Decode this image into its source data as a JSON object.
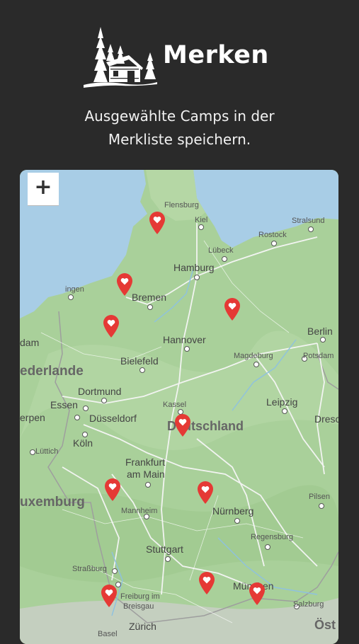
{
  "header": {
    "title": "Merken",
    "subtitle_line1": "Ausgewählte Camps in der",
    "subtitle_line2": "Merkliste speichern."
  },
  "map": {
    "zoom_in_label": "+",
    "labels": {
      "flensburg": "Flensburg",
      "kiel": "Kiel",
      "stralsund": "Stralsund",
      "rostock": "Rostock",
      "luebeck": "Lübeck",
      "hamburg": "Hamburg",
      "bremen": "Bremen",
      "groningen": "ingen",
      "hannover": "Hannover",
      "berlin": "Berlin",
      "potsdam": "Potsdam",
      "magdeburg": "Magdeburg",
      "bielefeld": "Bielefeld",
      "nederlande": "ederlande",
      "dam": "dam",
      "dortmund": "Dortmund",
      "essen": "Essen",
      "duesseldorf": "Düsseldorf",
      "erpen": "erpen",
      "kassel": "Kassel",
      "leipzig": "Leipzig",
      "dresden": "Dresc",
      "deutschland": "Deutschland",
      "koeln": "Köln",
      "luettich": "Lüttich",
      "frankfurt1": "Frankfurt",
      "frankfurt2": "am Main",
      "luxemburg": "uxemburg",
      "mannheim": "Mannheim",
      "nuernberg": "Nürnberg",
      "pilsen": "Pilsen",
      "regensburg": "Regensburg",
      "stuttgart": "Stuttgart",
      "strassburg": "Straßburg",
      "freiburg1": "Freiburg im",
      "freiburg2": "Breisgau",
      "muenchen": "München",
      "salzburg": "Salzburg",
      "zuerich": "Zürich",
      "basel": "Basel",
      "oest": "Öst"
    },
    "pin_count": 10,
    "colors": {
      "land": "#a9d09a",
      "water": "#a8cde6",
      "pin": "#e53935"
    }
  }
}
